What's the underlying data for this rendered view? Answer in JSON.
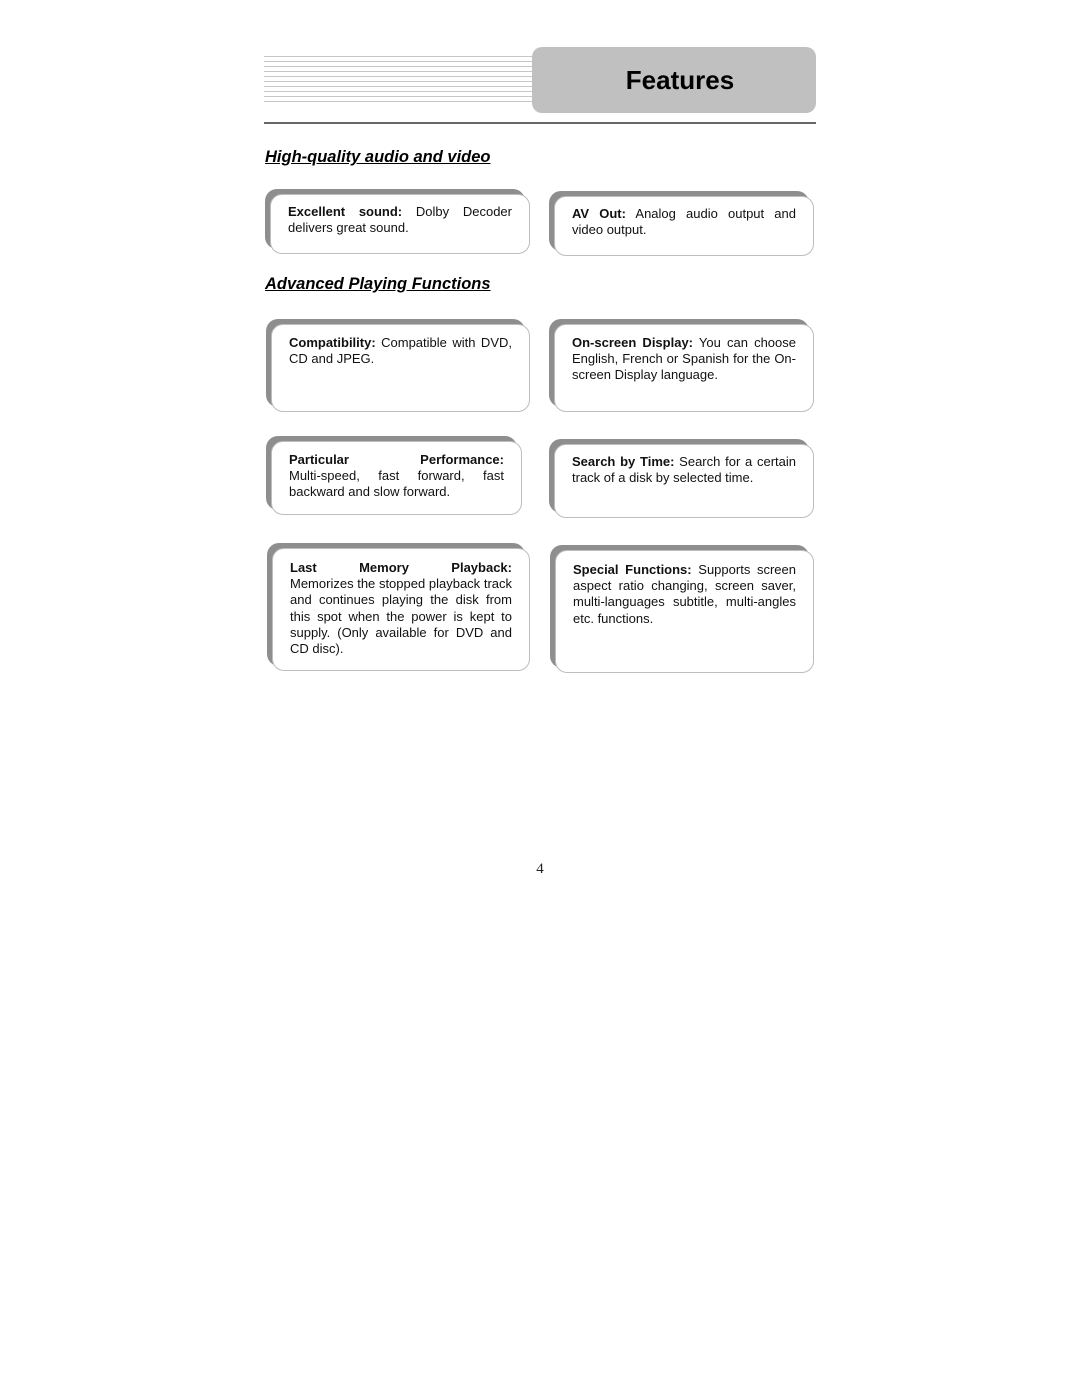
{
  "header": {
    "title": "Features"
  },
  "sections": [
    {
      "heading": "High-quality audio and video"
    },
    {
      "heading": "Advanced Playing Functions"
    }
  ],
  "features": {
    "excellent_sound": {
      "label": "Excellent sound:",
      "text": " Dolby Decoder delivers great sound."
    },
    "av_out": {
      "label": "AV Out:",
      "text": " Analog audio output and video output."
    },
    "compatibility": {
      "label": "Compatibility:",
      "text": " Compatible with DVD, CD and JPEG."
    },
    "on_screen_display": {
      "label": "On-screen Display:",
      "text": " You can choose English, French or Spanish for the On-screen Display language."
    },
    "particular_performance": {
      "label": "Particular Performance:",
      "text": "Multi-speed, fast forward, fast backward and slow forward."
    },
    "search_by_time": {
      "label": "Search by Time:",
      "text": " Search for a certain track of a disk by selected time."
    },
    "last_memory_playback": {
      "label": "Last Memory Playback:",
      "text": "Memorizes the stopped playback track and continues playing the disk from this spot when the power is kept to supply. (Only available for DVD and CD disc)."
    },
    "special_functions": {
      "label": "Special Functions:",
      "text": " Supports screen aspect ratio changing, screen saver, multi-languages subtitle, multi-angles etc. functions."
    }
  },
  "footer": {
    "page_number": "4"
  }
}
